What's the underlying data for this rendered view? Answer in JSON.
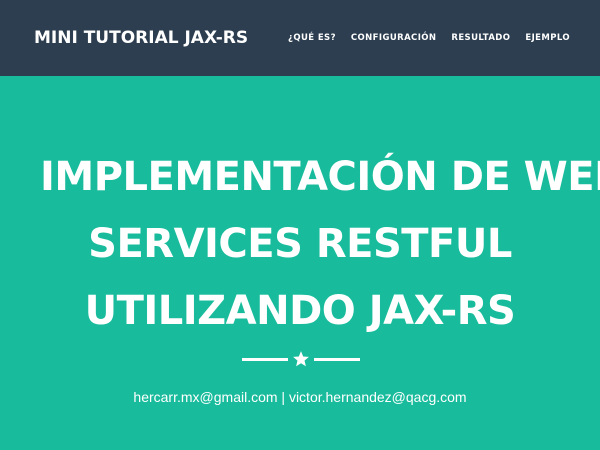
{
  "navbar": {
    "brand": "MINI TUTORIAL JAX-RS",
    "items": [
      {
        "label": "¿QUÉ ES?"
      },
      {
        "label": "CONFIGURACIÓN"
      },
      {
        "label": "RESULTADO"
      },
      {
        "label": "EJEMPLO"
      }
    ]
  },
  "hero": {
    "title_lines": [
      "IMPLEMENTACIÓN DE WEB",
      "SERVICES RESTFUL",
      "UTILIZANDO JAX-RS"
    ],
    "divider_icon": "star-icon",
    "contact": "hercarr.mx@gmail.com | victor.hernandez@qacg.com"
  },
  "colors": {
    "navbar_bg": "#2c3e50",
    "hero_bg": "#18bc9c",
    "text": "#ffffff"
  }
}
